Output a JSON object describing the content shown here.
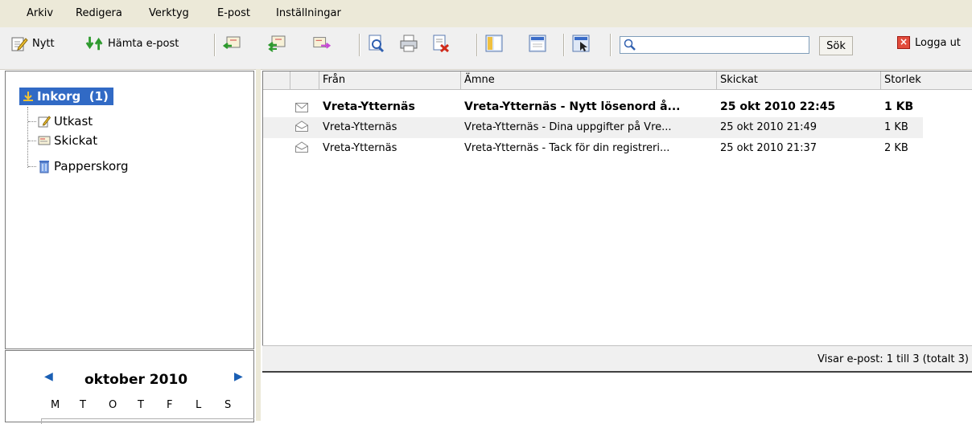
{
  "menu": [
    "Arkiv",
    "Redigera",
    "Verktyg",
    "E-post",
    "Inställningar"
  ],
  "toolbar": {
    "new_label": "Nytt",
    "fetch_label": "Hämta e-post",
    "search_value": "",
    "search_button": "Sök",
    "logout_label": "Logga ut"
  },
  "folders": {
    "inbox_label": "Inkorg  (1)",
    "items": [
      "Utkast",
      "Skickat",
      "Papperskorg"
    ]
  },
  "calendar": {
    "month": "oktober 2010",
    "weekdays": [
      "M",
      "T",
      "O",
      "T",
      "F",
      "L",
      "S"
    ]
  },
  "mail_list": {
    "columns": [
      "Från",
      "Ämne",
      "Skickat",
      "Storlek"
    ],
    "rows": [
      {
        "from": "Vreta-Ytternäs",
        "subject": "Vreta-Ytternäs - Nytt lösenord å...",
        "sent": "25 okt 2010 22:45",
        "size": "1 KB",
        "unread": true
      },
      {
        "from": "Vreta-Ytternäs",
        "subject": "Vreta-Ytternäs - Dina uppgifter på Vre...",
        "sent": "25 okt 2010 21:49",
        "size": "1 KB",
        "unread": false
      },
      {
        "from": "Vreta-Ytternäs",
        "subject": "Vreta-Ytternäs - Tack för din registreri...",
        "sent": "25 okt 2010 21:37",
        "size": "2 KB",
        "unread": false
      }
    ],
    "status": "Visar e-post: 1 till 3 (totalt 3)"
  },
  "colors": {
    "selection": "#316ac5",
    "menubar": "#ece9d8"
  }
}
